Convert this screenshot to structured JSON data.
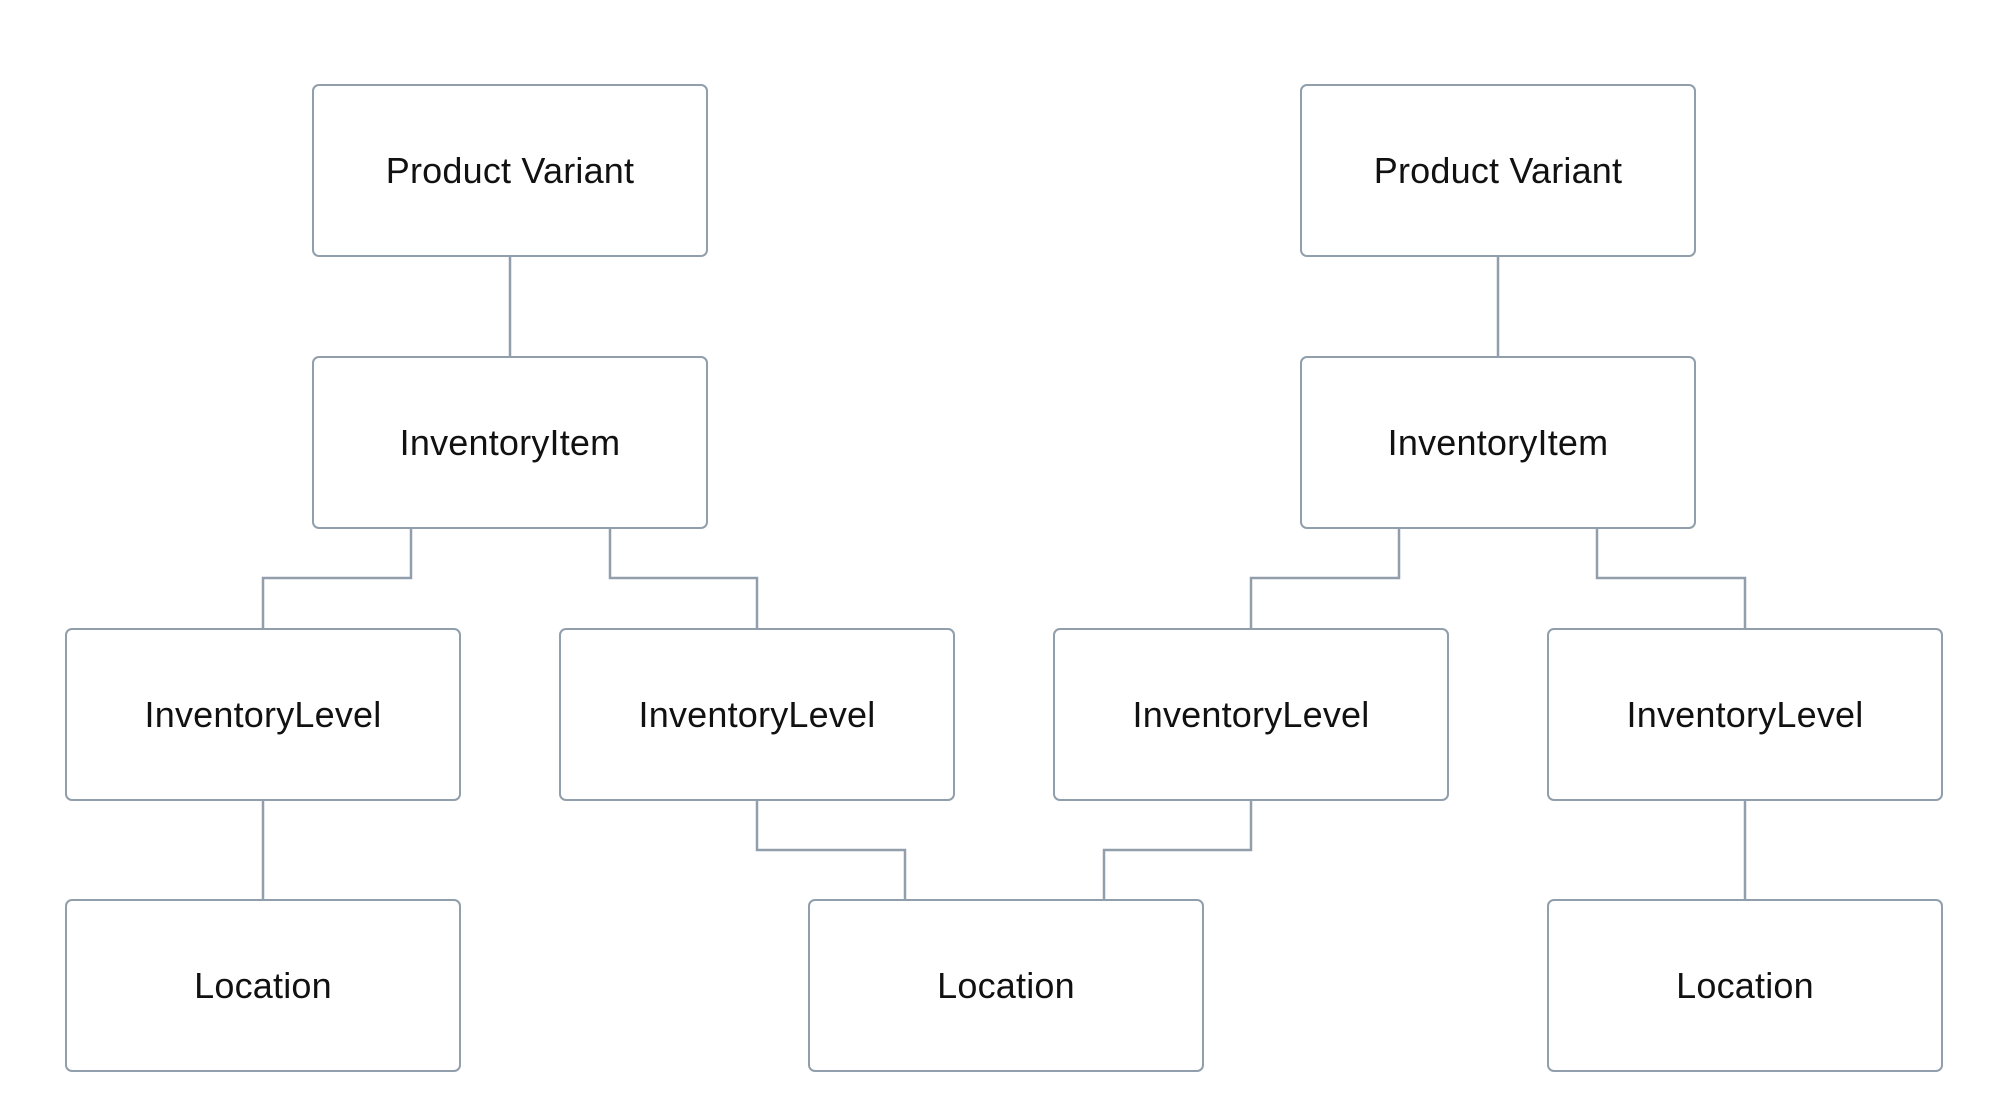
{
  "diagram": {
    "title": "",
    "colors": {
      "border": "#919eab",
      "text": "#111111",
      "background": "#ffffff"
    },
    "nodes": [
      {
        "id": "pv-left",
        "label": "Product Variant",
        "type": "product-variant"
      },
      {
        "id": "pv-right",
        "label": "Product Variant",
        "type": "product-variant"
      },
      {
        "id": "ii-left",
        "label": "InventoryItem",
        "type": "inventory-item"
      },
      {
        "id": "ii-right",
        "label": "InventoryItem",
        "type": "inventory-item"
      },
      {
        "id": "il-1",
        "label": "InventoryLevel",
        "type": "inventory-level"
      },
      {
        "id": "il-2",
        "label": "InventoryLevel",
        "type": "inventory-level"
      },
      {
        "id": "il-3",
        "label": "InventoryLevel",
        "type": "inventory-level"
      },
      {
        "id": "il-4",
        "label": "InventoryLevel",
        "type": "inventory-level"
      },
      {
        "id": "loc-1",
        "label": "Location",
        "type": "location"
      },
      {
        "id": "loc-2",
        "label": "Location",
        "type": "location"
      },
      {
        "id": "loc-3",
        "label": "Location",
        "type": "location"
      }
    ],
    "edges": [
      {
        "from": "pv-left",
        "to": "ii-left"
      },
      {
        "from": "pv-right",
        "to": "ii-right"
      },
      {
        "from": "ii-left",
        "to": "il-1"
      },
      {
        "from": "ii-left",
        "to": "il-2"
      },
      {
        "from": "ii-right",
        "to": "il-3"
      },
      {
        "from": "ii-right",
        "to": "il-4"
      },
      {
        "from": "il-1",
        "to": "loc-1"
      },
      {
        "from": "il-2",
        "to": "loc-2"
      },
      {
        "from": "il-3",
        "to": "loc-2"
      },
      {
        "from": "il-4",
        "to": "loc-3"
      }
    ]
  }
}
